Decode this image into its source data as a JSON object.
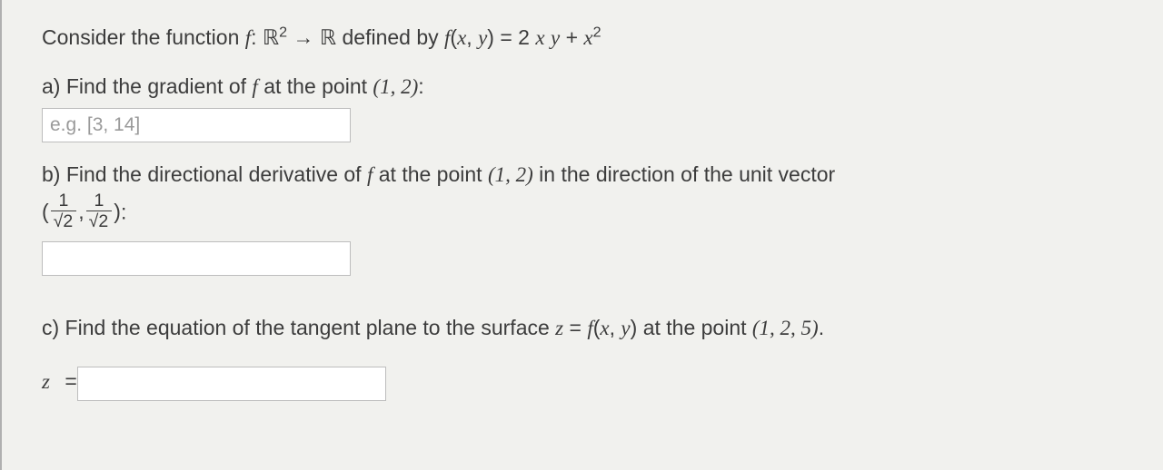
{
  "intro": {
    "prefix": "Consider the function ",
    "f_decl_html": "<span class='math'>f</span>: <span class='bb'>ℝ</span><sup>2</sup> → <span class='bb'>ℝ</span>",
    "mid": " defined by ",
    "f_def_html": "<span class='math'>f</span>(<span class='math'>x</span>, <span class='math'>y</span>) = 2 <span class='math'>x</span> <span class='math'>y</span> + <span class='math'>x</span><sup>2</sup>"
  },
  "part_a": {
    "label": "a) Find the gradient of ",
    "f_html": "<span class='math'>f</span>",
    "mid": " at the point ",
    "point_html": "(1, 2)",
    "colon": ":",
    "placeholder": "e.g. [3, 14]"
  },
  "part_b": {
    "label": "b) Find the directional derivative of ",
    "f_html": "<span class='math'>f</span>",
    "mid": " at the point ",
    "point_html": "(1, 2)",
    "tail": " in the direction of the unit vector",
    "vector_html": "(<span class='frac'><span class='num'>1</span><span class='den'><span class='sqrt'><span class='rad'>2</span></span></span></span>, <span class='frac'><span class='num'>1</span><span class='den'><span class='sqrt'><span class='rad'>2</span></span></span></span>)",
    "colon": ":"
  },
  "part_c": {
    "label": "c) Find the equation of the tangent plane to the surface ",
    "surf_html": "<span class='math'>z</span> = <span class='math'>f</span>(<span class='math'>x</span>, <span class='math'>y</span>)",
    "mid": " at the point ",
    "point_html": "(1, 2, 5)",
    "period": ".",
    "z_equals_html": "<span class='math'>z</span> <span class='rm'>=</span>"
  }
}
